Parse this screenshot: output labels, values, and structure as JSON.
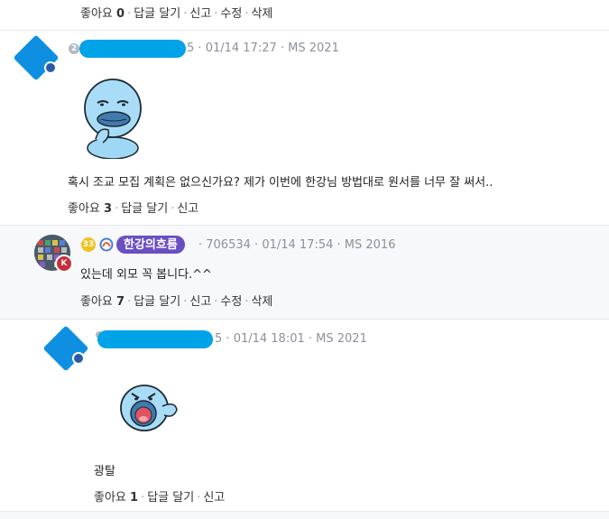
{
  "top_actions": {
    "like_label": "좋아요",
    "like_count": "0",
    "reply_label": "답글 달기",
    "report_label": "신고",
    "edit_label": "수정",
    "delete_label": "삭제"
  },
  "comment1": {
    "grade": "2",
    "author_suffix": "5",
    "timestamp": "01/14 17:27",
    "device": "MS 2021",
    "sticker": "duck-sticker-thinking",
    "text": "혹시 조교 모집 계획은 없으신가요? 제가 이번에 한강님 방법대로 원서를 너무 잘 써서..",
    "like_label": "좋아요",
    "like_count": "3",
    "reply_label": "답글 달기",
    "report_label": "신고"
  },
  "reply1": {
    "level": "33",
    "author": "한강의흐름",
    "author_id": "706534",
    "timestamp": "01/14 17:54",
    "device": "MS 2016",
    "avatar_badge": "K",
    "text": "있는데 외모 꼭 봅니다.^^",
    "like_label": "좋아요",
    "like_count": "7",
    "reply_label": "답글 달기",
    "report_label": "신고",
    "edit_label": "수정",
    "delete_label": "삭제"
  },
  "reply2": {
    "author_suffix": "5",
    "timestamp": "01/14 18:01",
    "device": "MS 2021",
    "sticker": "duck-sticker-shouting",
    "text": "광탈",
    "like_label": "좋아요",
    "like_count": "1",
    "reply_label": "답글 달기",
    "report_label": "신고"
  },
  "colors": {
    "nick_pill": "#6a4fc3",
    "avatar_diamond": "#0f8fe1",
    "redaction": "#00a3e8",
    "reply_background": "#f7f8fa"
  }
}
